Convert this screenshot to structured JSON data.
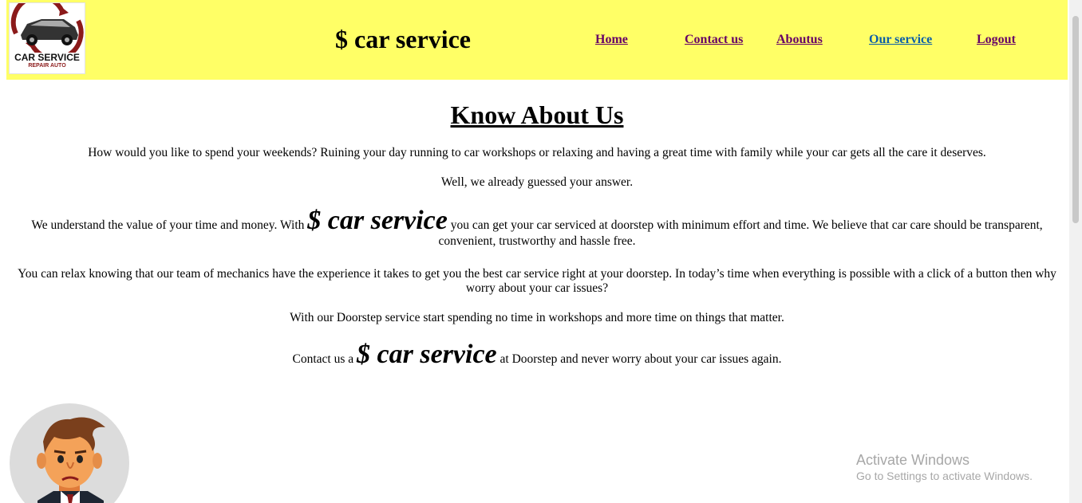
{
  "header": {
    "logo": {
      "title": "CAR SERVICE",
      "subtitle": "REPAIR AUTO"
    },
    "brand": "$ car service",
    "nav": [
      {
        "label": "Home",
        "active": false
      },
      {
        "label": "Contact us",
        "active": false
      },
      {
        "label": "Aboutus",
        "active": false
      },
      {
        "label": "Our service",
        "active": true
      },
      {
        "label": "Logout",
        "active": false
      }
    ]
  },
  "main": {
    "title": "Know About Us",
    "p1": "How would you like to spend your weekends? Ruining your day running to car workshops or relaxing and having a great time with family while your car gets all the care it deserves.",
    "p2": "Well, we already guessed your answer.",
    "p3": {
      "before": "We understand the value of your time and money. With",
      "brand": "$ car service",
      "after": "you can get your car serviced at doorstep with minimum effort and time. We believe that car care should be transparent, convenient, trustworthy and hassle free."
    },
    "p4": "You can relax knowing that our team of mechanics have the experience it takes to get you the best car service right at your doorstep. In today’s time when everything is possible with a click of a button then why worry about your car issues?",
    "p5": "With our Doorstep service start spending no time in workshops and more time on things that matter.",
    "p6": {
      "before": "Contact us a",
      "brand": "$ car service",
      "after": "at Doorstep and never worry about your car issues again."
    }
  },
  "watermark": {
    "title": "Activate Windows",
    "subtitle": "Go to Settings to activate Windows."
  },
  "colors": {
    "header_bg": "#ffff66",
    "nav_link": "#660066",
    "nav_active": "#0b5ea8"
  }
}
